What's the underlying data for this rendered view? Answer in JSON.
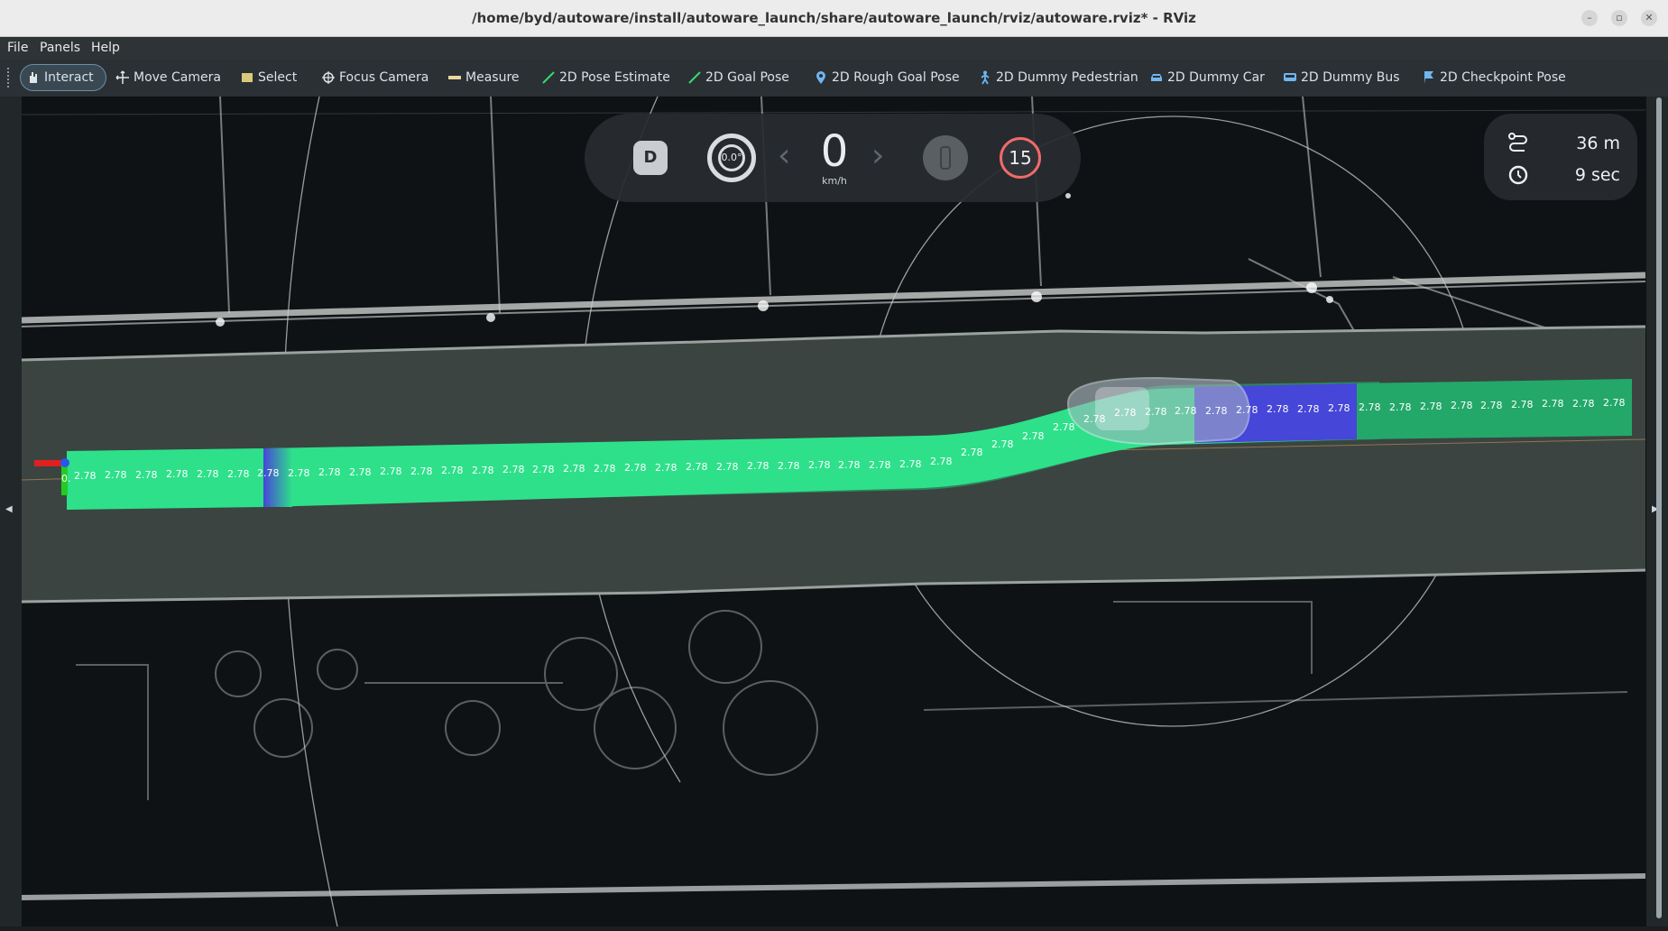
{
  "window": {
    "title": "/home/byd/autoware/install/autoware_launch/share/autoware_launch/rviz/autoware.rviz* - RViz"
  },
  "menu": [
    "File",
    "Panels",
    "Help"
  ],
  "toolbar": [
    {
      "label": "Interact",
      "icon": "hand-pointer-icon",
      "active": true
    },
    {
      "label": "Move Camera",
      "icon": "move-arrows-icon"
    },
    {
      "label": "Select",
      "icon": "select-box-icon"
    },
    {
      "label": "Focus Camera",
      "icon": "crosshair-icon"
    },
    {
      "label": "Measure",
      "icon": "ruler-icon"
    },
    {
      "label": "2D Pose Estimate",
      "icon": "green-arrow-icon"
    },
    {
      "label": "2D Goal Pose",
      "icon": "green-arrow-icon"
    },
    {
      "label": "2D Rough Goal Pose",
      "icon": "map-pin-icon"
    },
    {
      "label": "2D Dummy Pedestrian",
      "icon": "pedestrian-icon"
    },
    {
      "label": "2D Dummy Car",
      "icon": "car-icon"
    },
    {
      "label": "2D Dummy Bus",
      "icon": "bus-icon"
    },
    {
      "label": "2D Checkpoint Pose",
      "icon": "flag-icon"
    }
  ],
  "hud": {
    "gear": "D",
    "steering_angle": "0.0°",
    "speed": "0",
    "speed_unit": "km/h",
    "speed_limit": "15",
    "traffic_light_icon": "traffic-light-icon"
  },
  "route_info": {
    "distance": "36 m",
    "time": "9 sec"
  },
  "trajectory": {
    "label_value": "2.78",
    "first_label": "0.",
    "colors": {
      "path": "#2ee08a",
      "path_dark": "#23a86a",
      "blue_segment": "#4646d8",
      "road": "#3b4440"
    }
  }
}
